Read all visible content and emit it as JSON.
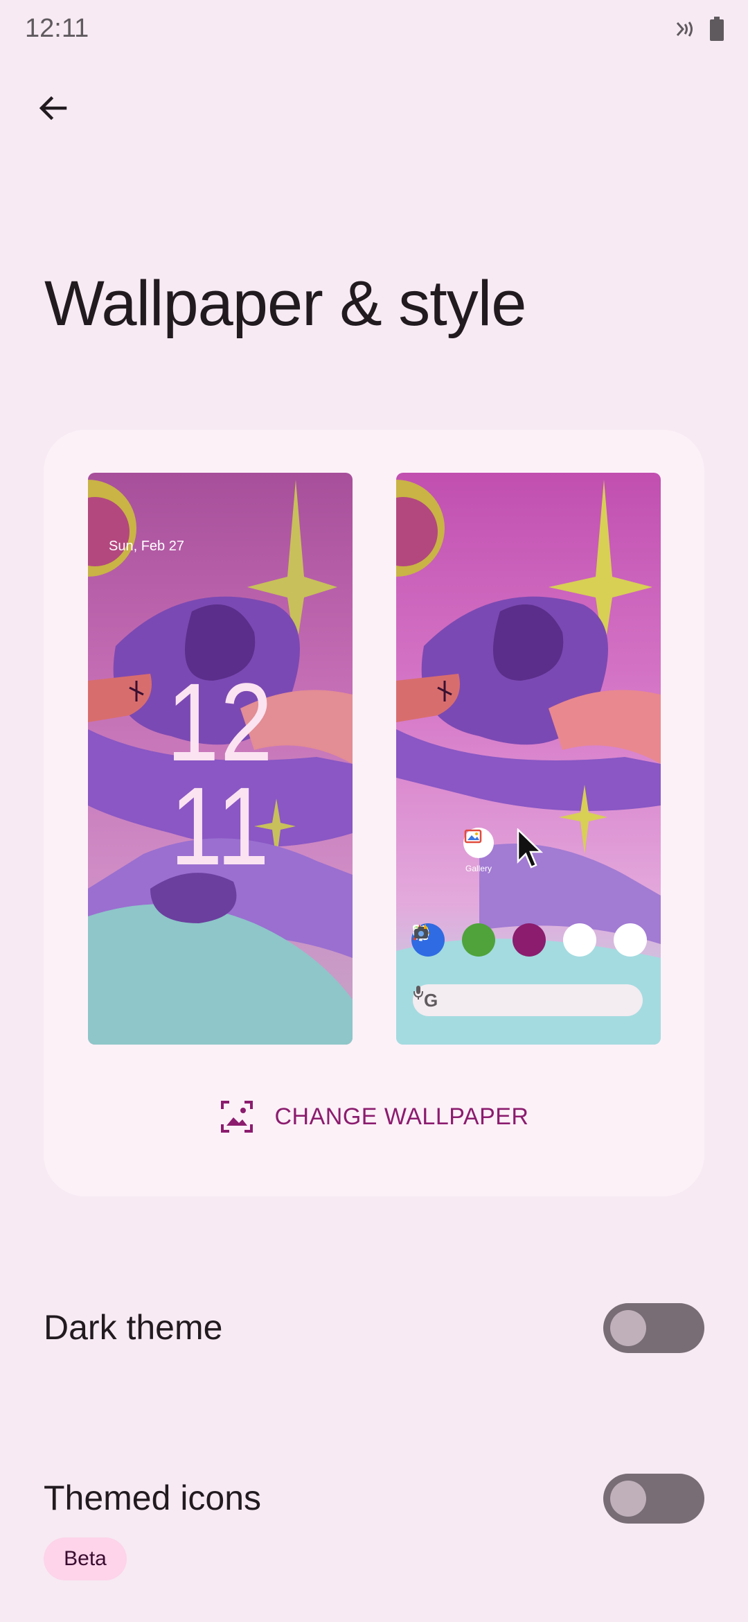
{
  "status_bar": {
    "time": "12:11",
    "icons": [
      "nfc-signal-icon",
      "battery-icon"
    ]
  },
  "header": {
    "back_icon": "arrow-back-icon",
    "title": "Wallpaper & style"
  },
  "preview": {
    "lock_screen": {
      "date": "Sun, Feb 27",
      "clock_hour": "12",
      "clock_minute": "11"
    },
    "home_screen": {
      "app_label": "Gallery",
      "dock_icons": [
        "phone-icon",
        "messages-icon",
        "settings-icon",
        "maps-go-icon",
        "camera-go-icon"
      ],
      "search_icons": [
        "google-g-icon",
        "mic-icon"
      ]
    }
  },
  "change_wallpaper": {
    "label": "CHANGE WALLPAPER",
    "icon": "wallpaper-icon"
  },
  "settings": {
    "dark_theme": {
      "label": "Dark theme",
      "enabled": false
    },
    "themed_icons": {
      "label": "Themed icons",
      "enabled": false,
      "badge": "Beta"
    }
  },
  "colors": {
    "background": "#f7eaf3",
    "card": "#fdf1f8",
    "accent": "#8b1c6e",
    "toggle_track": "#786c75",
    "toggle_thumb": "#bfb0ba",
    "beta_badge": "#fdd4ea"
  }
}
